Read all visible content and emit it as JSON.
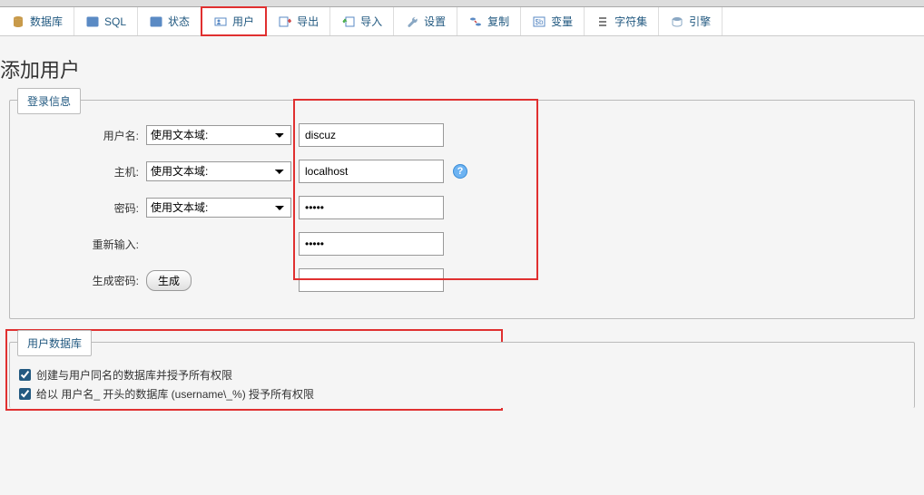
{
  "tabs": [
    {
      "label": "数据库"
    },
    {
      "label": "SQL"
    },
    {
      "label": "状态"
    },
    {
      "label": "用户"
    },
    {
      "label": "导出"
    },
    {
      "label": "导入"
    },
    {
      "label": "设置"
    },
    {
      "label": "复制"
    },
    {
      "label": "变量"
    },
    {
      "label": "字符集"
    },
    {
      "label": "引擎"
    }
  ],
  "page_title": "添加用户",
  "login_section": {
    "legend": "登录信息",
    "username_label": "用户名:",
    "username_select": "使用文本域:",
    "username_value": "discuz",
    "host_label": "主机:",
    "host_select": "使用文本域:",
    "host_value": "localhost",
    "password_label": "密码:",
    "password_select": "使用文本域:",
    "password_value": "•••••",
    "retype_label": "重新输入:",
    "retype_value": "•••••",
    "generate_label": "生成密码:",
    "generate_btn": "生成"
  },
  "userdb_section": {
    "legend": "用户数据库",
    "checkbox1": "创建与用户同名的数据库并授予所有权限",
    "checkbox2": "给以 用户名_ 开头的数据库 (username\\_%) 授予所有权限"
  }
}
